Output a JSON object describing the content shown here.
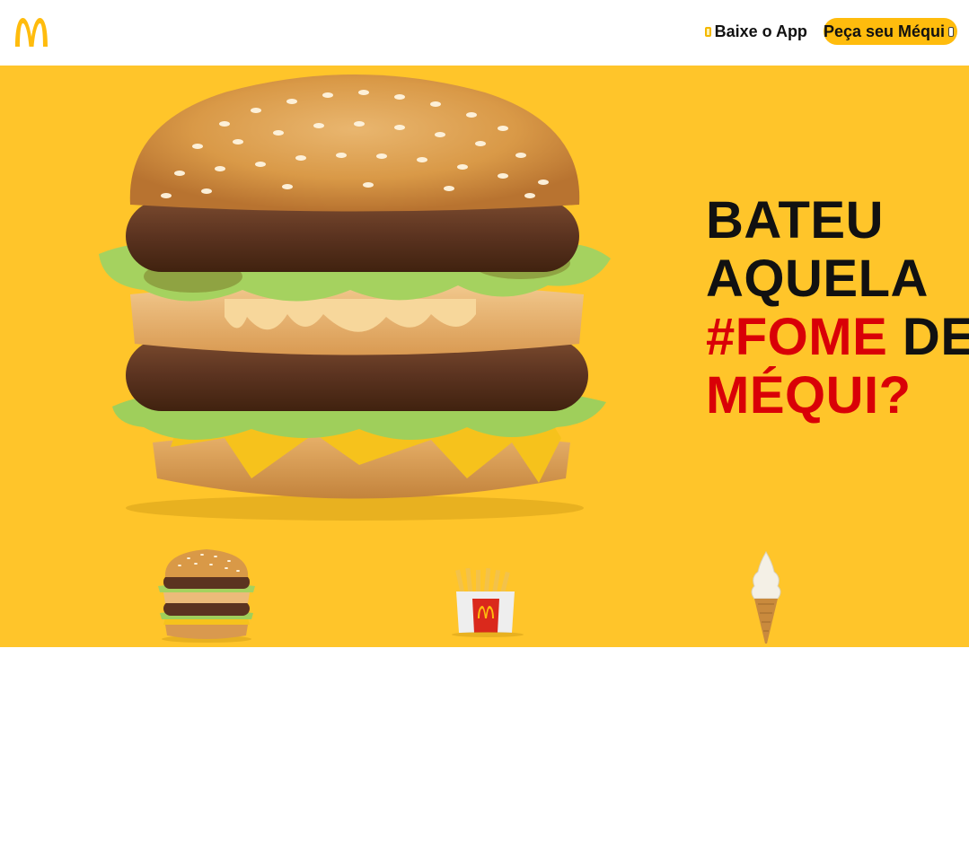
{
  "brand": {
    "logo_icon": "golden-arches-icon",
    "accent_color": "#ffbc0d",
    "hero_background": "#ffc52a",
    "highlight_color": "#d90007"
  },
  "header": {
    "app_link": {
      "icon": "phone-icon",
      "label": "Baixe o App"
    },
    "order_button": {
      "label": "Peça seu Méqui",
      "icon": "phone-icon"
    }
  },
  "hero": {
    "headline": {
      "line1": "BATEU",
      "line2": "AQUELA",
      "line3_highlight": "#FOME",
      "line3_rest": " DE",
      "line4": "MÉQUI?"
    },
    "main_image": "big-mac-burger",
    "thumbnails": [
      {
        "name": "big-mac-thumbnail",
        "image": "burger"
      },
      {
        "name": "fries-thumbnail",
        "image": "fries"
      },
      {
        "name": "ice-cream-cone-thumbnail",
        "image": "ice-cream-cone"
      }
    ]
  }
}
